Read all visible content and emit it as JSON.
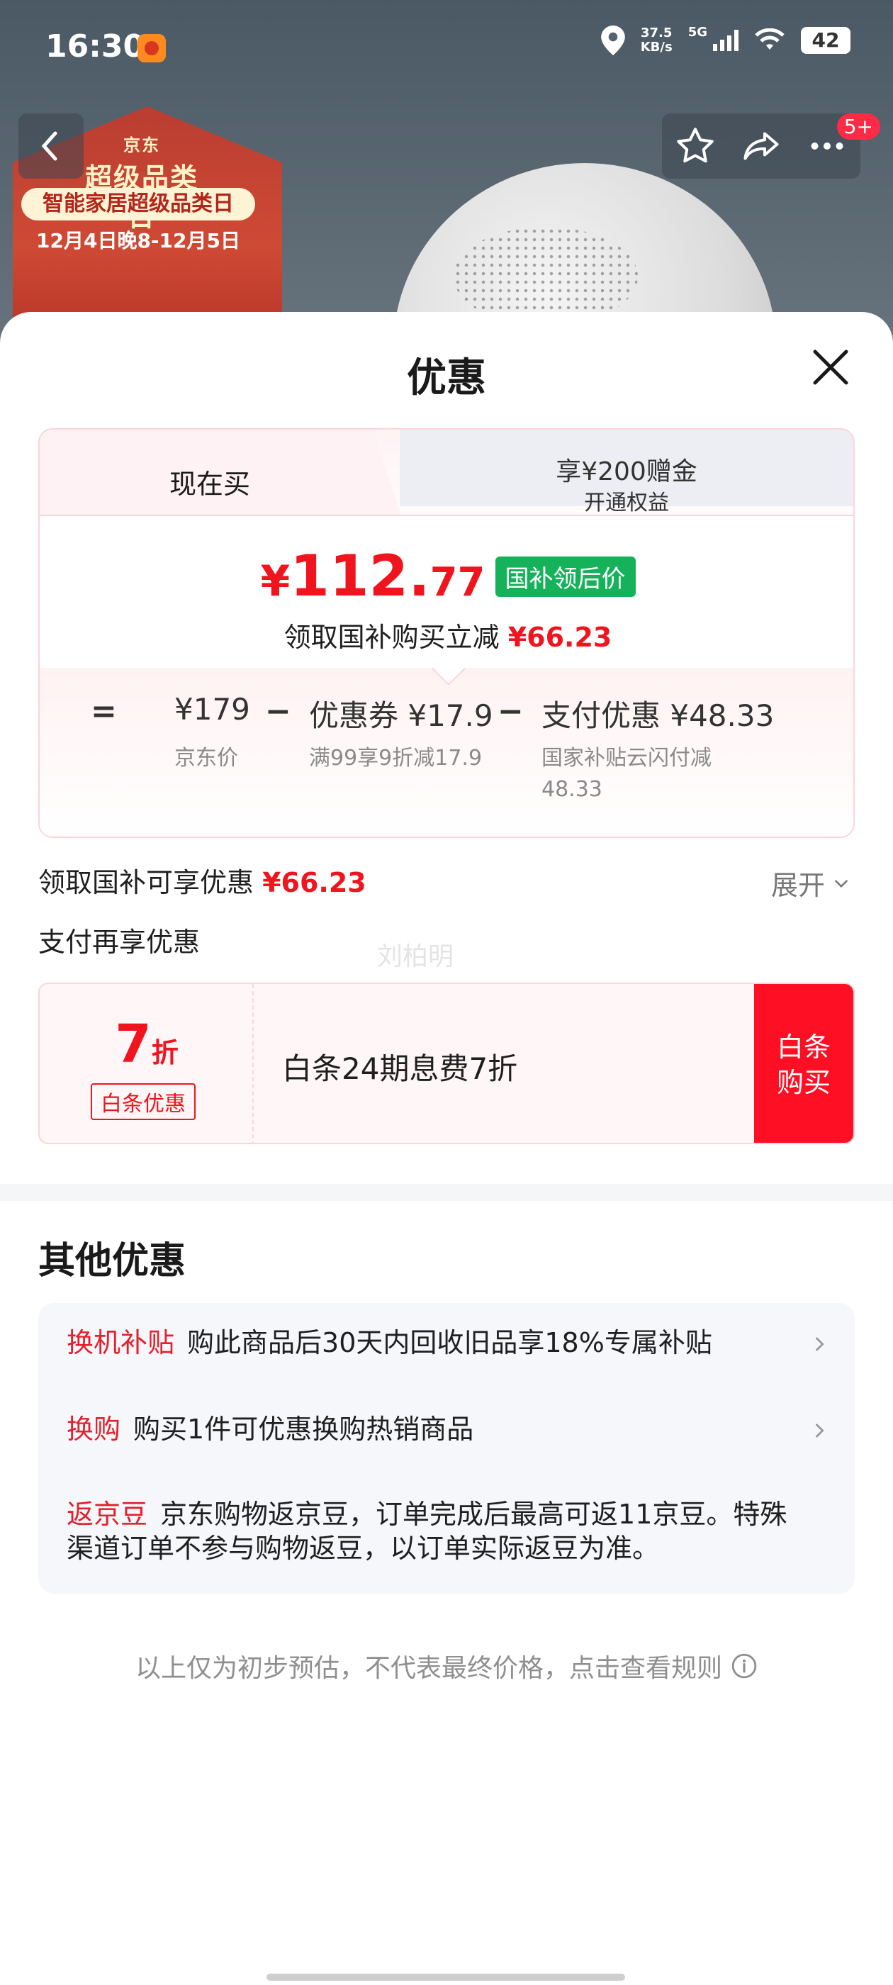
{
  "status_bar": {
    "time": "16:30",
    "net_speed_value": "37.5",
    "net_speed_unit": "KB/s",
    "network": "5G",
    "battery": "42"
  },
  "background": {
    "poster_brand": "京东",
    "poster_title": "超级品类日",
    "poster_subtitle": "智能家居超级品类日",
    "poster_date": "12月4日晚8-12月5日",
    "cart_badge": "5+"
  },
  "sheet": {
    "title": "优惠"
  },
  "price_card": {
    "tab_now": "现在买",
    "tab_gift": "享¥200赠金",
    "tab_gift_sub": "开通权益",
    "price_currency": "¥",
    "price_int": "112.",
    "price_dec": "77",
    "price_tag": "国补领后价",
    "note_prefix": "领取国补购买立减",
    "note_amount": "¥66.23",
    "breakdown": {
      "eq": "=",
      "minus": "−",
      "jd_price": "¥179",
      "jd_price_label": "京东价",
      "coupon": "优惠券 ¥17.9",
      "coupon_desc": "满99享9折减17.9",
      "pay": "支付优惠 ¥48.33",
      "pay_desc_line1": "国家补贴云闪付减",
      "pay_desc_line2": "48.33"
    }
  },
  "gov_row": {
    "label": "领取国补可享优惠",
    "amount": "¥66.23",
    "expand": "展开"
  },
  "pay_row": {
    "label": "支付再享优惠",
    "watermark": "刘柏明"
  },
  "baitiao": {
    "rate": "7",
    "rate_unit": "折",
    "tag": "白条优惠",
    "title": "白条24期息费7折",
    "button_line1": "白条",
    "button_line2": "购买"
  },
  "other": {
    "title": "其他优惠",
    "items": [
      {
        "label": "换机补贴",
        "text": "购此商品后30天内回收旧品享18%专属补贴"
      },
      {
        "label": "换购",
        "text": "购买1件可优惠换购热销商品"
      },
      {
        "label": "返京豆",
        "text": "京东购物返京豆，订单完成后最高可返11京豆。特殊渠道订单不参与购物返豆，以订单实际返豆为准。"
      }
    ]
  },
  "disclaimer": "以上仅为初步预估，不代表最终价格，点击查看规则",
  "colors": {
    "accent_red": "#f0141e",
    "gov_green": "#16b25a",
    "button_red": "#ff0f23"
  }
}
